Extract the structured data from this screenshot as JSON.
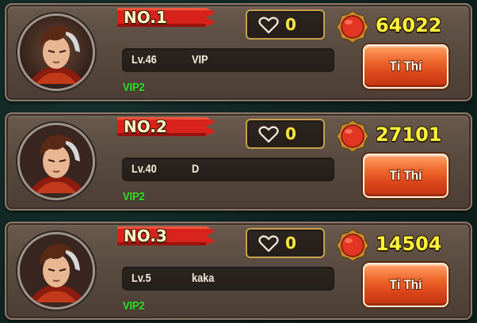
{
  "leaderboard": {
    "entries": [
      {
        "rank": "NO.1",
        "level": "Lv.46",
        "name": "VIP",
        "vip": "VIP2",
        "likes": "0",
        "power": "64022",
        "button_label": "Tỉ Thí"
      },
      {
        "rank": "NO.2",
        "level": "Lv.40",
        "name": "D",
        "vip": "VIP2",
        "likes": "0",
        "power": "27101",
        "button_label": "Tỉ Thí"
      },
      {
        "rank": "NO.3",
        "level": "Lv.5",
        "name": "kaka",
        "vip": "VIP2",
        "likes": "0",
        "power": "14504",
        "button_label": "Tỉ Thí"
      }
    ]
  },
  "icons": {
    "avatar": "hero-portrait-avatar",
    "like": "heart-outline-icon",
    "power": "red-gem-icon"
  },
  "colors": {
    "rank_ribbon": "#d8231c",
    "vip_text": "#35e02a",
    "power_text": "#fff23a",
    "button": "#e5521f"
  }
}
